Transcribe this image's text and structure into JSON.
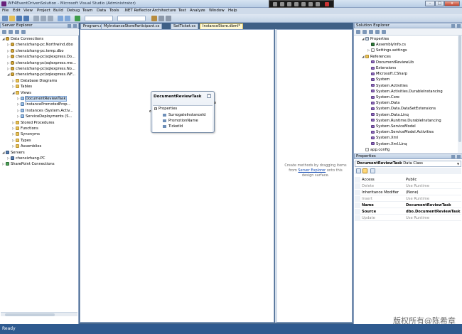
{
  "window": {
    "title": "WF4EventDrivenSolution - Microsoft Visual Studio (Administrator)",
    "buttons": [
      "-",
      "□",
      "x"
    ]
  },
  "menu": [
    "File",
    "Edit",
    "View",
    "Project",
    "Build",
    "Debug",
    "Team",
    "Data",
    "Tools",
    ".NET Reflector",
    "Architecture",
    "Test",
    "Analyze",
    "Window",
    "Help"
  ],
  "server_explorer": {
    "title": "Server Explorer",
    "items": [
      {
        "label": "Data Connections",
        "depth": 0,
        "exp": "◢",
        "icon": "db"
      },
      {
        "label": "chenxizhang-pc.Northwind.dbo",
        "depth": 1,
        "exp": "▷",
        "icon": "db"
      },
      {
        "label": "chenxizhang-pc.temp.dbo",
        "depth": 1,
        "exp": "▷",
        "icon": "db"
      },
      {
        "label": "chenxizhang-pc\\sqlexpress.Do...",
        "depth": 1,
        "exp": "▷",
        "icon": "db"
      },
      {
        "label": "chenxizhang-pc\\sqlexpress.me...",
        "depth": 1,
        "exp": "▷",
        "icon": "db"
      },
      {
        "label": "chenxizhang-pc\\sqlexpress.No...",
        "depth": 1,
        "exp": "▷",
        "icon": "db"
      },
      {
        "label": "chenxizhang-pc\\sqlexpress.WF...",
        "depth": 1,
        "exp": "◢",
        "icon": "db"
      },
      {
        "label": "Database Diagrams",
        "depth": 2,
        "exp": "▷",
        "icon": "folder"
      },
      {
        "label": "Tables",
        "depth": 2,
        "exp": "▷",
        "icon": "folder"
      },
      {
        "label": "Views",
        "depth": 2,
        "exp": "◢",
        "icon": "folder"
      },
      {
        "label": "DocumentReviewTask",
        "depth": 3,
        "exp": "▷",
        "icon": "view",
        "selected": true
      },
      {
        "label": "InstancePromotedProp...",
        "depth": 3,
        "exp": "▷",
        "icon": "view"
      },
      {
        "label": "Instances (System.Activ...",
        "depth": 3,
        "exp": "▷",
        "icon": "view"
      },
      {
        "label": "ServiceDeployments (S...",
        "depth": 3,
        "exp": "▷",
        "icon": "view"
      },
      {
        "label": "Stored Procedures",
        "depth": 2,
        "exp": "▷",
        "icon": "folder"
      },
      {
        "label": "Functions",
        "depth": 2,
        "exp": "▷",
        "icon": "folder"
      },
      {
        "label": "Synonyms",
        "depth": 2,
        "exp": "▷",
        "icon": "folder"
      },
      {
        "label": "Types",
        "depth": 2,
        "exp": "▷",
        "icon": "folder"
      },
      {
        "label": "Assemblies",
        "depth": 2,
        "exp": "▷",
        "icon": "folder"
      },
      {
        "label": "Servers",
        "depth": 0,
        "exp": "◢",
        "icon": "server"
      },
      {
        "label": "chenxizhang-PC",
        "depth": 1,
        "exp": "▷",
        "icon": "server"
      },
      {
        "label": "SharePoint Connections",
        "depth": 0,
        "exp": "▷",
        "icon": "share"
      }
    ]
  },
  "tabs": [
    {
      "label": "Program.cs",
      "active": false
    },
    {
      "label": "MyInstanceStoreParticipant.cs",
      "active": false
    },
    {
      "label": "SetTicket.cs",
      "active": false
    },
    {
      "label": "InstanceStore.dbml*",
      "active": true
    }
  ],
  "entity": {
    "title": "DocumentReviewTask",
    "section": "Properties",
    "properties": [
      "SurrogateInstanceId",
      "PromotionName",
      "TicketId"
    ]
  },
  "methods_pane": {
    "hint_before": "Create methods by dragging items from ",
    "hint_link": "Server Explorer",
    "hint_after": " onto this design surface."
  },
  "solution_explorer": {
    "title": "Solution Explorer",
    "items": [
      {
        "label": "Properties",
        "depth": 1,
        "exp": "◢",
        "icon": "props"
      },
      {
        "label": "AssemblyInfo.cs",
        "depth": 2,
        "exp": "",
        "icon": "cs"
      },
      {
        "label": "Settings.settings",
        "depth": 2,
        "exp": "▷",
        "icon": "file"
      },
      {
        "label": "References",
        "depth": 1,
        "exp": "◢",
        "icon": "folder"
      },
      {
        "label": "DocumentReviewLib",
        "depth": 2,
        "exp": "",
        "icon": "ref"
      },
      {
        "label": "Extensions",
        "depth": 2,
        "exp": "",
        "icon": "ref"
      },
      {
        "label": "Microsoft.CSharp",
        "depth": 2,
        "exp": "",
        "icon": "ref"
      },
      {
        "label": "System",
        "depth": 2,
        "exp": "",
        "icon": "ref"
      },
      {
        "label": "System.Activities",
        "depth": 2,
        "exp": "",
        "icon": "ref"
      },
      {
        "label": "System.Activities.DurableInstancing",
        "depth": 2,
        "exp": "",
        "icon": "ref"
      },
      {
        "label": "System.Core",
        "depth": 2,
        "exp": "",
        "icon": "ref"
      },
      {
        "label": "System.Data",
        "depth": 2,
        "exp": "",
        "icon": "ref"
      },
      {
        "label": "System.Data.DataSetExtensions",
        "depth": 2,
        "exp": "",
        "icon": "ref"
      },
      {
        "label": "System.Data.Linq",
        "depth": 2,
        "exp": "",
        "icon": "ref"
      },
      {
        "label": "System.Runtime.DurableInstancing",
        "depth": 2,
        "exp": "",
        "icon": "ref"
      },
      {
        "label": "System.ServiceModel",
        "depth": 2,
        "exp": "",
        "icon": "ref"
      },
      {
        "label": "System.ServiceModel.Activities",
        "depth": 2,
        "exp": "",
        "icon": "ref"
      },
      {
        "label": "System.Xml",
        "depth": 2,
        "exp": "",
        "icon": "ref"
      },
      {
        "label": "System.Xml.Linq",
        "depth": 2,
        "exp": "",
        "icon": "ref"
      },
      {
        "label": "app.config",
        "depth": 1,
        "exp": "",
        "icon": "file"
      }
    ]
  },
  "properties": {
    "title": "Properties",
    "object_name": "DocumentReviewTask",
    "object_type": "Data Class",
    "rows": [
      {
        "name": "Access",
        "value": "Public",
        "style": ""
      },
      {
        "name": "Delete",
        "value": "Use Runtime",
        "style": "ro"
      },
      {
        "name": "Inheritance Modifier",
        "value": "(None)",
        "style": ""
      },
      {
        "name": "Insert",
        "value": "Use Runtime",
        "style": "ro"
      },
      {
        "name": "Name",
        "value": "DocumentReviewTask",
        "style": "bold"
      },
      {
        "name": "Source",
        "value": "dbo.DocumentReviewTask",
        "style": "bold"
      },
      {
        "name": "Update",
        "value": "Use Runtime",
        "style": "ro"
      }
    ]
  },
  "status": "Ready",
  "watermark": "版权所有@陈希章"
}
